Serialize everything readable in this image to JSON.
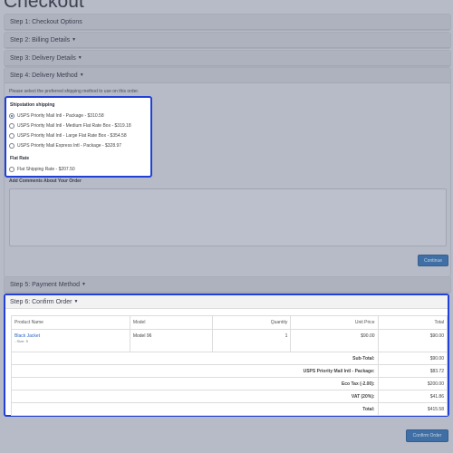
{
  "page": {
    "title": "Checkout"
  },
  "steps": {
    "step1": "Step 1: Checkout Options",
    "step2": "Step 2: Billing Details",
    "step3": "Step 3: Delivery Details",
    "step4": "Step 4: Delivery Method",
    "step5": "Step 5: Payment Method",
    "step6": "Step 6: Confirm Order"
  },
  "delivery": {
    "hint": "Please select the preferred shipping method to use on this order.",
    "groups": [
      {
        "title": "Shipstation shipping",
        "options": [
          {
            "label": "USPS Priority Mail Intl - Package - $310.58",
            "selected": true
          },
          {
            "label": "USPS Priority Mail Intl - Medium Flat Rate Box - $319.18",
            "selected": false
          },
          {
            "label": "USPS Priority Mail Intl - Large Flat Rate Box - $354.58",
            "selected": false
          },
          {
            "label": "USPS Priority Mail Express Intl - Package - $328.97",
            "selected": false
          }
        ]
      },
      {
        "title": "Flat Rate",
        "options": [
          {
            "label": "Flat Shipping Rate - $207.50",
            "selected": false
          }
        ]
      }
    ],
    "comments_label": "Add Comments About Your Order",
    "continue_label": "Continue"
  },
  "order": {
    "headers": [
      "Product Name",
      "Model",
      "Quantity",
      "Unit Price",
      "Total"
    ],
    "items": [
      {
        "name": "Black Jacket",
        "option": "- Size: S",
        "model": "Model 96",
        "quantity": "1",
        "unit_price": "$90.00",
        "total": "$90.00"
      }
    ],
    "totals": [
      {
        "label": "Sub-Total:",
        "value": "$90.00"
      },
      {
        "label": "USPS Priority Mail Intl - Package:",
        "value": "$83.72"
      },
      {
        "label": "Eco Tax (-2.00):",
        "value": "$200.00"
      },
      {
        "label": "VAT (20%):",
        "value": "$41.86"
      },
      {
        "label": "Total:",
        "value": "$415.58"
      }
    ],
    "confirm_label": "Confirm Order"
  },
  "colors": {
    "highlight_border": "#2040d8",
    "button": "#3f6fa5",
    "link": "#2b63c8",
    "overlay_bg": "#b7bbc7"
  }
}
